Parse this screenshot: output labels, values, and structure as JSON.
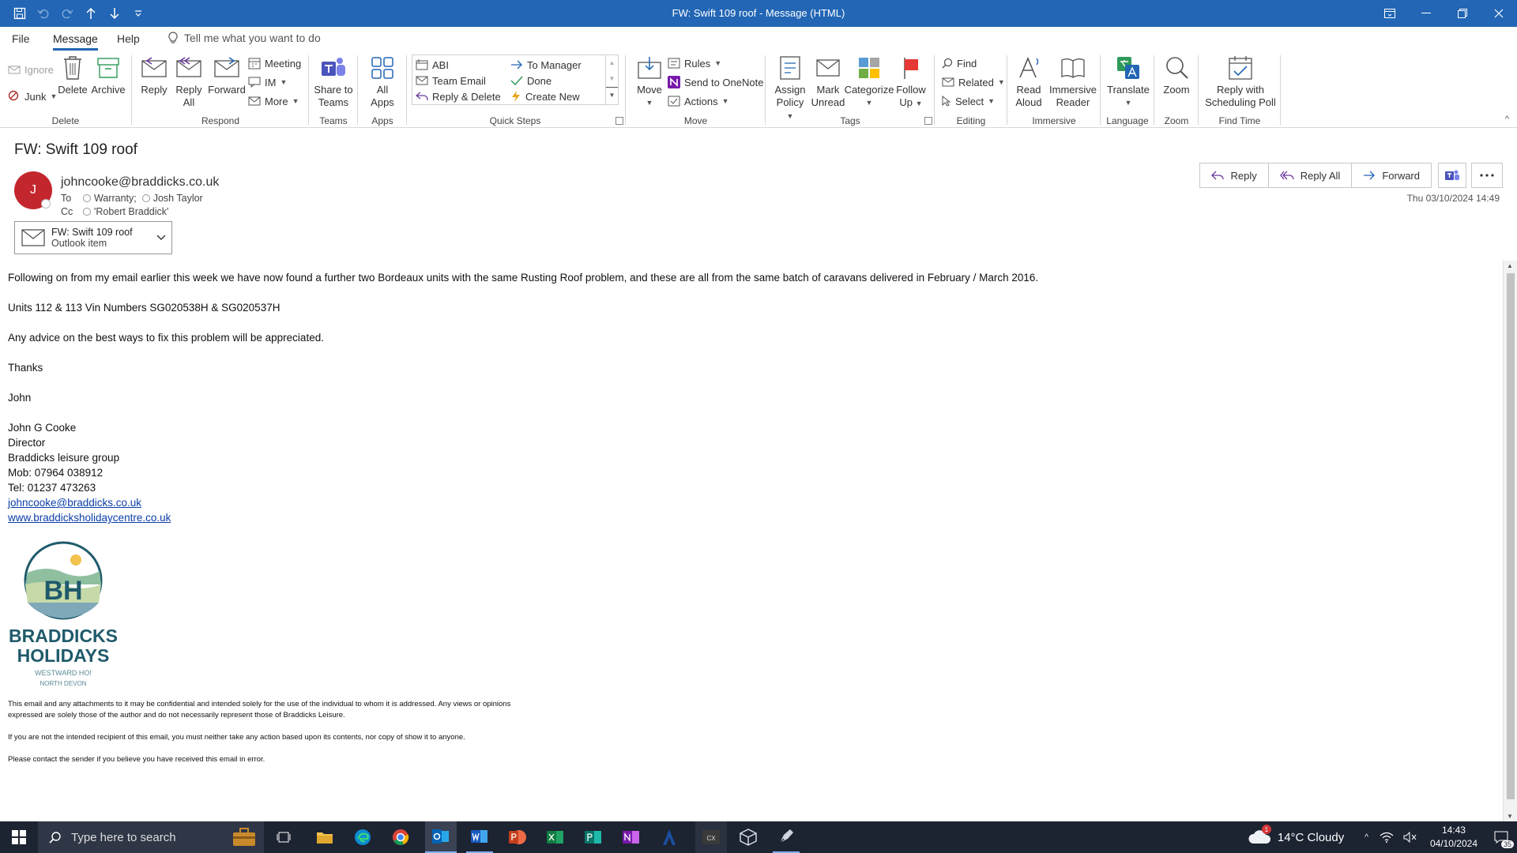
{
  "window": {
    "title": "FW: Swift 109 roof  -  Message (HTML)"
  },
  "menu": {
    "file": "File",
    "message": "Message",
    "help": "Help",
    "tell_me": "Tell me what you want to do"
  },
  "ribbon": {
    "delete": {
      "label": "Delete",
      "ignore": "Ignore",
      "junk": "Junk",
      "delete": "Delete",
      "archive": "Archive"
    },
    "respond": {
      "label": "Respond",
      "reply": "Reply",
      "reply_all_1": "Reply",
      "reply_all_2": "All",
      "forward": "Forward",
      "meeting": "Meeting",
      "im": "IM",
      "more": "More"
    },
    "teams": {
      "label": "Teams",
      "share_1": "Share to",
      "share_2": "Teams"
    },
    "apps": {
      "label": "Apps",
      "all_1": "All",
      "all_2": "Apps"
    },
    "quicksteps": {
      "label": "Quick Steps",
      "items": [
        "ABI",
        "To Manager",
        "Team Email",
        "Done",
        "Reply & Delete",
        "Create New"
      ]
    },
    "move": {
      "label": "Move",
      "move": "Move",
      "rules": "Rules",
      "onenote": "Send to OneNote",
      "actions": "Actions"
    },
    "tags": {
      "label": "Tags",
      "assign_1": "Assign",
      "assign_2": "Policy",
      "mark_1": "Mark",
      "mark_2": "Unread",
      "categorize": "Categorize",
      "follow_1": "Follow",
      "follow_2": "Up"
    },
    "editing": {
      "label": "Editing",
      "find": "Find",
      "related": "Related",
      "select": "Select"
    },
    "immersive": {
      "label": "Immersive",
      "read_1": "Read",
      "read_2": "Aloud",
      "imm_1": "Immersive",
      "imm_2": "Reader"
    },
    "language": {
      "label": "Language",
      "translate": "Translate"
    },
    "zoom": {
      "label": "Zoom",
      "zoom": "Zoom"
    },
    "findtime": {
      "label": "Find Time",
      "reply_1": "Reply with",
      "reply_2": "Scheduling Poll"
    }
  },
  "message": {
    "subject": "FW: Swift 109 roof",
    "avatar_initial": "J",
    "sender": "johncooke@braddicks.co.uk",
    "to_label": "To",
    "to": [
      "Warranty;",
      "Josh Taylor"
    ],
    "cc_label": "Cc",
    "cc": [
      "'Robert Braddick'"
    ],
    "attachment": {
      "name": "FW: Swift 109 roof",
      "type": "Outlook item"
    },
    "actions": {
      "reply": "Reply",
      "reply_all": "Reply All",
      "forward": "Forward"
    },
    "datetime": "Thu 03/10/2024 14:49"
  },
  "body": {
    "p1": "Following on from my email earlier this week we have now found a further two Bordeaux units with the same Rusting Roof problem, and these are all from the same batch of caravans delivered in February / March 2016.",
    "p2": "Units 112 & 113 Vin Numbers SG020538H & SG020537H",
    "p3": "Any advice on the best ways to fix this problem will be appreciated.",
    "p4": "Thanks",
    "p5": "John",
    "sig": [
      "John G Cooke",
      "Director",
      "Braddicks leisure group",
      "Mob: 07964 038912",
      "Tel: 01237 473263"
    ],
    "email_link": "johncooke@braddicks.co.uk",
    "web_link": "www.braddicksholidaycentre.co.uk",
    "logo": {
      "initials": "BH",
      "line1": "BRADDICKS",
      "line2": "HOLIDAYS",
      "line3": "WESTWARD HO!",
      "line4": "NORTH DEVON"
    },
    "disclaimer1": "This email and any attachments to it may be confidential and intended solely for the use of the individual to whom it is addressed. Any views or opinions",
    "disclaimer1b": "expressed are solely those of the author and do not necessarily represent those of Braddicks Leisure.",
    "disclaimer2": "If you are not the intended recipient of this email, you must neither take any action based upon its contents, nor copy of show it to anyone.",
    "disclaimer3": "Please contact the sender if you believe you have received this email in error."
  },
  "taskbar": {
    "search": "Type here to search",
    "weather": "14°C  Cloudy",
    "weather_badge": "1",
    "time": "14:43",
    "date": "04/10/2024",
    "notif": "35"
  },
  "colors": {
    "titlebar": "#2266b5",
    "avatar": "#c4262e",
    "taskbar": "#1c2331",
    "logo_teal": "#1f5a6b"
  }
}
